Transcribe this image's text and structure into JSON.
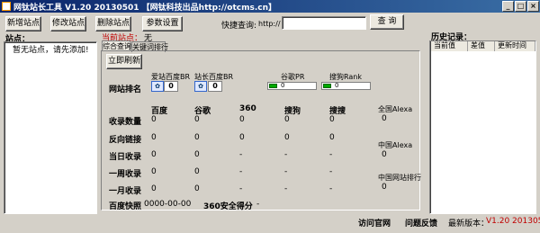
{
  "window": {
    "title": "网钛站长工具 V1.20 20130501 【网钛科技出品http://otcms.cn】",
    "min": "_",
    "max": "□",
    "close": "×"
  },
  "toolbar": {
    "add_site": "新增站点",
    "edit_site": "修改站点",
    "delete_site": "删除站点",
    "settings": "参数设置",
    "quick_query_label": "快捷查询:",
    "url_prefix": "http://",
    "url_value": "",
    "query_button": "查 询"
  },
  "sites": {
    "label": "站点：",
    "current_label": "当前站点：",
    "current_value": "无",
    "items": [
      "暂无站点，请先添加!"
    ]
  },
  "tabs": [
    "综合查询",
    "关键词排行"
  ],
  "refresh_button": "立即刷新",
  "rank": {
    "row_label": "网站排名",
    "aizhan_label": "爱站百度BR",
    "aizhan_value": "0",
    "chinaz_label": "站长百度BR",
    "chinaz_value": "0",
    "google_pr_label": "谷歌PR",
    "google_pr_value": "0",
    "sogou_rank_label": "搜狗Rank",
    "sogou_rank_value": "0"
  },
  "stats": {
    "columns": [
      "百度",
      "谷歌",
      "360",
      "搜狗",
      "搜搜"
    ],
    "rows": [
      {
        "label": "收录数量",
        "values": [
          "0",
          "0",
          "0",
          "0",
          "0"
        ]
      },
      {
        "label": "反向链接",
        "values": [
          "0",
          "0",
          "0",
          "0",
          "0"
        ]
      },
      {
        "label": "当日收录",
        "values": [
          "0",
          "0",
          "-",
          "-",
          "-"
        ]
      },
      {
        "label": "一周收录",
        "values": [
          "0",
          "0",
          "-",
          "-",
          "-"
        ]
      },
      {
        "label": "一月收录",
        "values": [
          "0",
          "0",
          "-",
          "-",
          "-"
        ]
      }
    ],
    "snapshot_label": "百度快照",
    "snapshot_value": "0000-00-00",
    "safety_label": "360安全得分",
    "safety_value": "-"
  },
  "alexa": {
    "global_label": "全国Alexa",
    "global_value": "0",
    "china_label": "中国Alexa",
    "china_value": "0",
    "china_rank_label": "中国网站排行",
    "china_rank_value": "0"
  },
  "history": {
    "label": "历史记录：",
    "columns": [
      "当前值",
      "差值",
      "更新时间"
    ]
  },
  "footer": {
    "visit_site": "访问官网",
    "feedback": "问题反馈",
    "latest_version_label": "最新版本：",
    "latest_version_value": "V1.20 20130501"
  },
  "colors": {
    "title_gradient_start": "#0a246a",
    "title_gradient_end": "#3a6ea5",
    "accent_red": "#c00000",
    "window_bg": "#d4d0c8"
  }
}
